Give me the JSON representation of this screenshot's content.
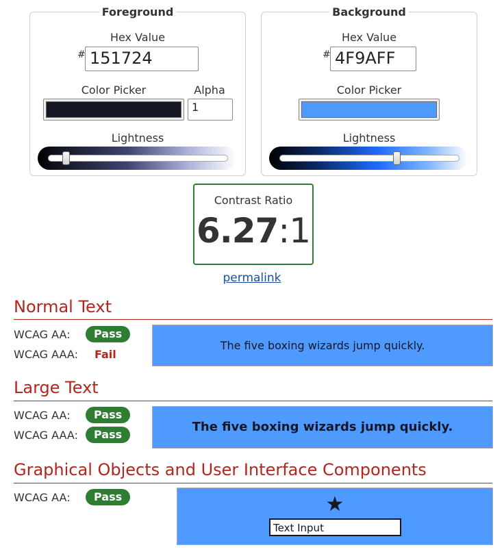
{
  "foreground": {
    "title": "Foreground",
    "hex_label": "Hex Value",
    "hash": "#",
    "hex_value": "151724",
    "picker_label": "Color Picker",
    "alpha_label": "Alpha",
    "alpha_value": "1",
    "lightness_label": "Lightness",
    "swatch_color": "#151724",
    "lightness_level": 0.1
  },
  "background": {
    "title": "Background",
    "hex_label": "Hex Value",
    "hash": "#",
    "hex_value": "4F9AFF",
    "picker_label": "Color Picker",
    "lightness_label": "Lightness",
    "swatch_color": "#4F9AFF",
    "lightness_level": 0.65
  },
  "contrast": {
    "label": "Contrast Ratio",
    "ratio": "6.27",
    "suffix": ":1",
    "permalink": "permalink"
  },
  "sections": {
    "normal": {
      "title": "Normal Text",
      "aa_label": "WCAG AA:",
      "aa_result": "Pass",
      "aaa_label": "WCAG AAA:",
      "aaa_result": "Fail",
      "sample": "The five boxing wizards jump quickly."
    },
    "large": {
      "title": "Large Text",
      "aa_label": "WCAG AA:",
      "aa_result": "Pass",
      "aaa_label": "WCAG AAA:",
      "aaa_result": "Pass",
      "sample": "The five boxing wizards jump quickly."
    },
    "graphical": {
      "title": "Graphical Objects and User Interface Components",
      "aa_label": "WCAG AA:",
      "aa_result": "Pass",
      "icon": "star-icon",
      "input_value": "Text Input"
    }
  },
  "colors": {
    "pass": "#2e7d32",
    "fail": "#b3261e",
    "heading": "#b3261e"
  }
}
